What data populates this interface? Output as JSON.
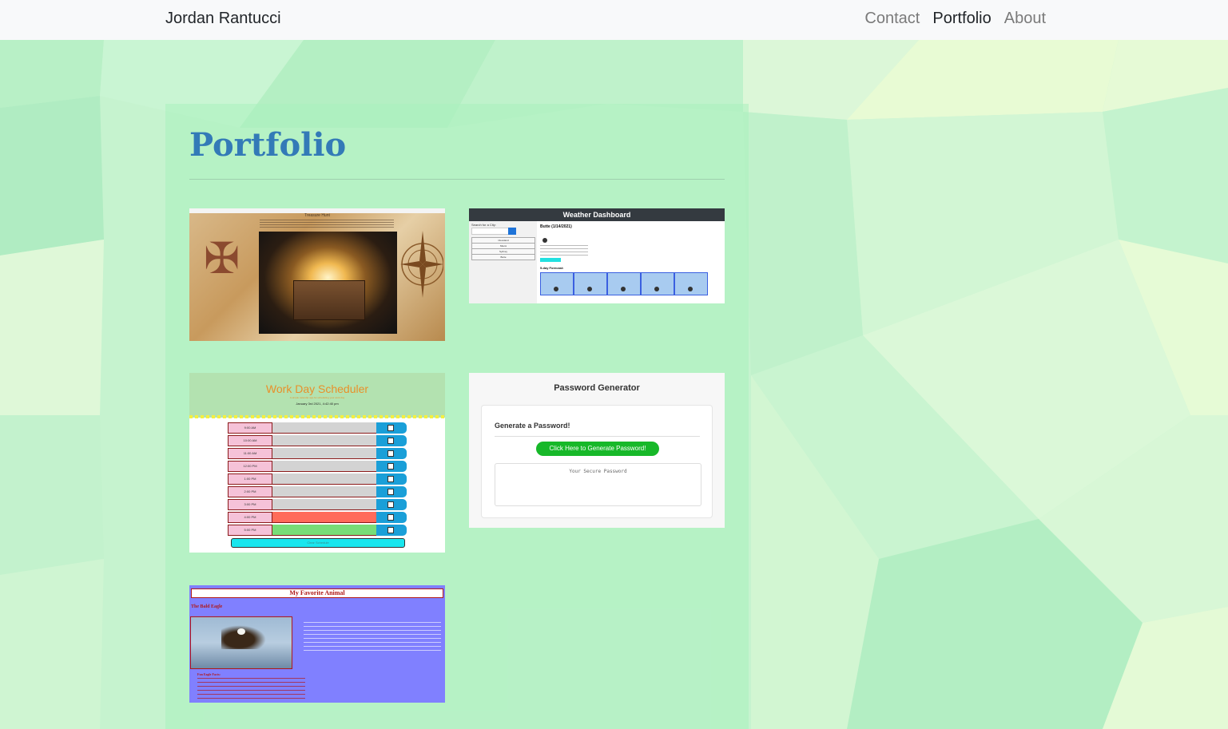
{
  "navbar": {
    "brand": "Jordan Rantucci",
    "links": [
      {
        "label": "Contact",
        "active": false
      },
      {
        "label": "Portfolio",
        "active": true
      },
      {
        "label": "About",
        "active": false
      }
    ]
  },
  "main": {
    "title": "Portfolio",
    "projects": {
      "treasure": {
        "title": "Treasure Hunt"
      },
      "weather": {
        "header": "Weather Dashboard",
        "search_label": "Search for a City:",
        "cities": [
          "Cleveland",
          "Miami",
          "Sydney",
          "Butte"
        ],
        "city_date": "Butte (1/14/2021)",
        "forecast_label": "5-day Forecast:"
      },
      "scheduler": {
        "title": "Work Day Scheduler",
        "subtitle": "A simple calendar app for scheduling your work day",
        "date": "January 3rd 2021, 4:42:40 pm",
        "hours": [
          "9:00 AM",
          "10:00 AM",
          "11:00 AM",
          "12:00 PM",
          "1:00 PM",
          "2:00 PM",
          "3:00 PM",
          "4:00 PM",
          "5:00 PM"
        ],
        "clear_label": "Clear Schedule"
      },
      "password": {
        "title": "Password Generator",
        "subtitle": "Generate a Password!",
        "button": "Click Here to Generate Password!",
        "placeholder": "Your Secure Password"
      },
      "animal": {
        "title": "My Favorite Animal",
        "subtitle": "The Bald Eagle",
        "facts_title": "Fun Eagle Facts:"
      }
    }
  },
  "colors": {
    "title_blue": "#337ab7",
    "navbar_bg": "#f8f9fa",
    "past_hour": "#d3d3d3",
    "present_hour": "#ff6b5a",
    "future_hour": "#77dd77"
  }
}
